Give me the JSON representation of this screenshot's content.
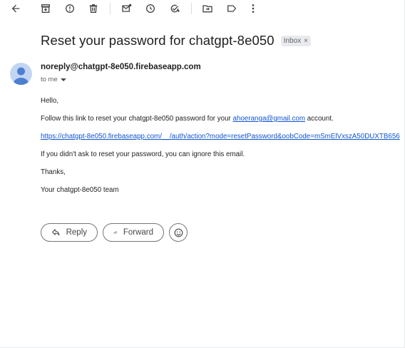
{
  "toolbar": {
    "icons": [
      "back-arrow-icon",
      "archive-icon",
      "report-spam-icon",
      "delete-icon",
      "mark-unread-icon",
      "snooze-icon",
      "add-task-icon",
      "move-to-icon",
      "label-icon",
      "more-vert-icon"
    ]
  },
  "email": {
    "subject": "Reset your password for chatgpt-8e050",
    "label": "Inbox",
    "label_close": "×",
    "sender": "noreply@chatgpt-8e050.firebaseapp.com",
    "to": "to me",
    "greeting": "Hello,",
    "line1_prefix": "Follow this link to reset your chatgpt-8e050 password for your ",
    "line1_email": "ahoeranga@gmail.com",
    "line1_suffix": " account.",
    "reset_link": "https://chatgpt-8e050.firebaseapp.com/__/auth/action?mode=resetPassword&oobCode=mSmElVxszA50DUXTB656",
    "ignore_line": "If you didn't ask to reset your password, you can ignore this email.",
    "thanks": "Thanks,",
    "signature": "Your chatgpt-8e050 team"
  },
  "actions": {
    "reply": "Reply",
    "forward": "Forward"
  },
  "colors": {
    "link": "#1155cc",
    "avatar_bg": "#c2d6f4",
    "avatar_fg": "#4d7fd1"
  }
}
